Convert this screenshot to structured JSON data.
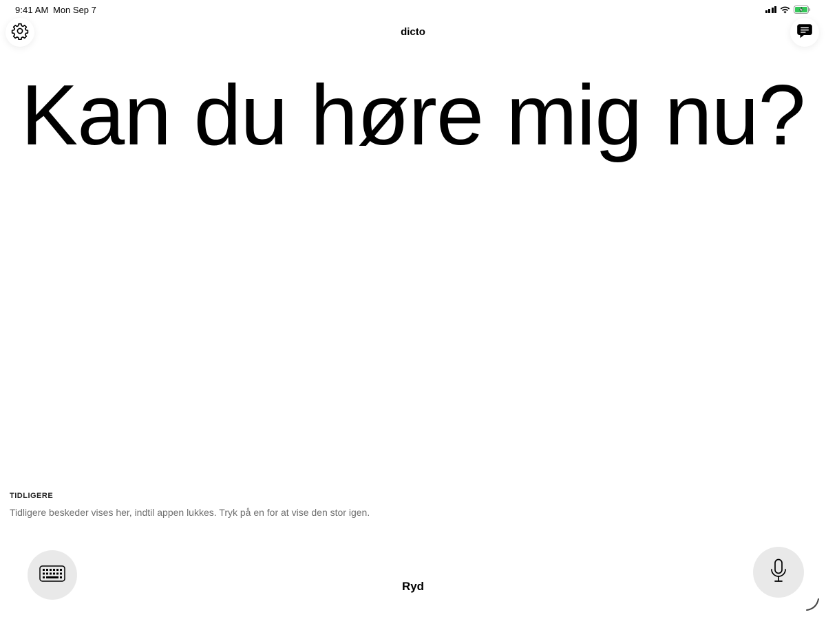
{
  "status_bar": {
    "time": "9:41 AM",
    "date": "Mon Sep 7",
    "icons": [
      "cellular-signal-icon",
      "wifi-icon",
      "battery-charging-icon"
    ]
  },
  "header": {
    "title": "dicto",
    "left_icon": "gear-icon",
    "right_icon": "message-bubble-icon"
  },
  "main": {
    "message": "Kan du høre mig nu?"
  },
  "history": {
    "heading": "TIDLIGERE",
    "hint": "Tidligere beskeder vises her, indtil appen lukkes. Tryk på en for at vise den stor igen."
  },
  "footer": {
    "left_icon": "keyboard-icon",
    "clear_label": "Ryd",
    "right_icon": "microphone-icon"
  },
  "colors": {
    "background": "#ffffff",
    "text": "#000000",
    "muted_text": "#6f6f6f",
    "button_bg": "#e9e9e9",
    "battery_green": "#34c759"
  }
}
